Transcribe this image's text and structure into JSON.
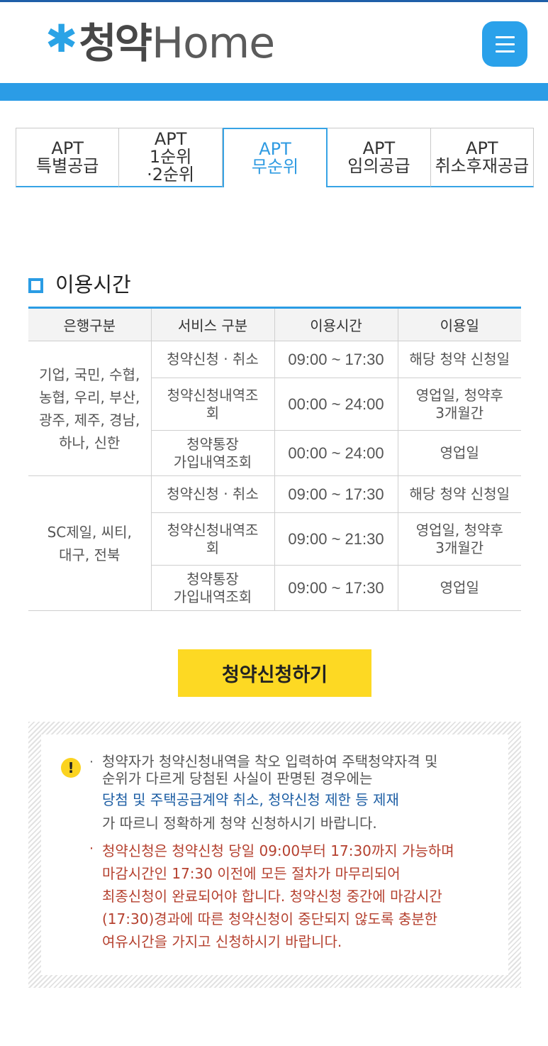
{
  "header": {
    "logo_ko": "청약",
    "logo_en": "Home",
    "menu_icon": "hamburger-menu-icon"
  },
  "tabs": [
    {
      "line1": "APT",
      "line2": "특별공급",
      "line3": ""
    },
    {
      "line1": "APT",
      "line2": "1순위",
      "line3": "·2순위"
    },
    {
      "line1": "APT",
      "line2": "무순위",
      "line3": ""
    },
    {
      "line1": "APT",
      "line2": "임의공급",
      "line3": ""
    },
    {
      "line1": "APT",
      "line2": "취소후재공급",
      "line3": ""
    }
  ],
  "active_tab": "APT 무순위",
  "section": {
    "title": "이용시간"
  },
  "table": {
    "headers": [
      "은행구분",
      "서비스 구분",
      "이용시간",
      "이용일"
    ],
    "groups": [
      {
        "bank_lines": [
          "기업, 국민, 수협,",
          "농협, 우리, 부산,",
          "광주, 제주, 경남,",
          "하나, 신한"
        ],
        "rows": [
          {
            "service": [
              "청약신청 · 취소"
            ],
            "time": "09:00 ~ 17:30",
            "days": [
              "해당 청약 신청일"
            ]
          },
          {
            "service": [
              "청약신청내역조",
              "회"
            ],
            "time": "00:00 ~ 24:00",
            "days": [
              "영업일, 청약후",
              "3개월간"
            ]
          },
          {
            "service": [
              "청약통장",
              "가입내역조회"
            ],
            "time": "00:00 ~ 24:00",
            "days": [
              "영업일"
            ]
          }
        ]
      },
      {
        "bank_lines": [
          "SC제일, 씨티,",
          "대구, 전북"
        ],
        "rows": [
          {
            "service": [
              "청약신청 · 취소"
            ],
            "time": "09:00 ~ 17:30",
            "days": [
              "해당 청약 신청일"
            ]
          },
          {
            "service": [
              "청약신청내역조",
              "회"
            ],
            "time": "09:00 ~ 21:30",
            "days": [
              "영업일, 청약후",
              "3개월간"
            ]
          },
          {
            "service": [
              "청약통장",
              "가입내역조회"
            ],
            "time": "09:00 ~ 17:30",
            "days": [
              "영업일"
            ]
          }
        ]
      }
    ]
  },
  "apply_button": "청약신청하기",
  "notice": {
    "icon": "exclamation-icon",
    "bullet": "·",
    "p1_line1": "청약자가 청약신청내역을 착오 입력하여 주택청약자격 및",
    "p1_line2": "순위가 다르게 당첨된 사실이 판명된 경우에는",
    "p1_highlight": "당첨 및 주택공급계약 취소, 청약신청 제한 등 제재",
    "p1_last": "가 따르니 정확하게 청약 신청하시기 바랍니다.",
    "p2_lines": [
      "청약신청은 청약신청 당일 09:00부터 17:30까지 가능하며",
      "마감시간인 17:30 이전에 모든 절차가 마무리되어",
      "최종신청이 완료되어야 합니다. 청약신청 중간에 마감시간",
      "(17:30)경과에 따른 청약신청이 중단되지 않도록 충분한",
      "여유시간을 가지고 신청하시기 바랍니다."
    ]
  },
  "colors": {
    "brand_blue": "#2b9ce6",
    "button_yellow": "#fdd923",
    "warning_red": "#b5412f",
    "highlight_blue": "#1d5ea4"
  }
}
